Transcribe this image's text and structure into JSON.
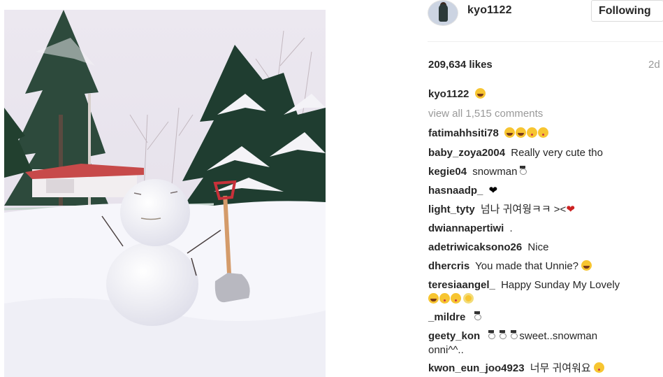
{
  "post": {
    "username": "kyo1122",
    "follow_label": "Following",
    "likes": "209,634 likes",
    "time_ago": "2d",
    "caption_username": "kyo1122",
    "view_all_label": "view all 1,515 comments"
  },
  "comments": [
    {
      "user": "fatimahhsiti78",
      "text": ""
    },
    {
      "user": "baby_zoya2004",
      "text": "Really very cute tho"
    },
    {
      "user": "kegie04",
      "text": "snowman"
    },
    {
      "user": "hasnaadp_",
      "text": ""
    },
    {
      "user": "light_tyty",
      "text": "넘나 귀여웡ㅋㅋ ><"
    },
    {
      "user": "dwiannapertiwi",
      "text": "."
    },
    {
      "user": "adetriwicaksono26",
      "text": "Nice"
    },
    {
      "user": "dhercris",
      "text": "You made that Unnie?"
    },
    {
      "user": "teresiaangel_",
      "text": "Happy Sunday My Lovely"
    },
    {
      "user": "_mildre",
      "text": ""
    },
    {
      "user": "geety_kon",
      "text": "sweet..snowman",
      "text2": "onni^^.."
    },
    {
      "user": "kwon_eun_joo4923",
      "text": "너무 귀여워요"
    }
  ],
  "icons": {
    "avatar": "profile-photo",
    "emoji_grin": "grinning-face",
    "emoji_kiss": "kissing-face",
    "snowman": "snowman",
    "heart_black": "black-heart",
    "heart_red": "red-heart",
    "flower": "sunflower"
  }
}
